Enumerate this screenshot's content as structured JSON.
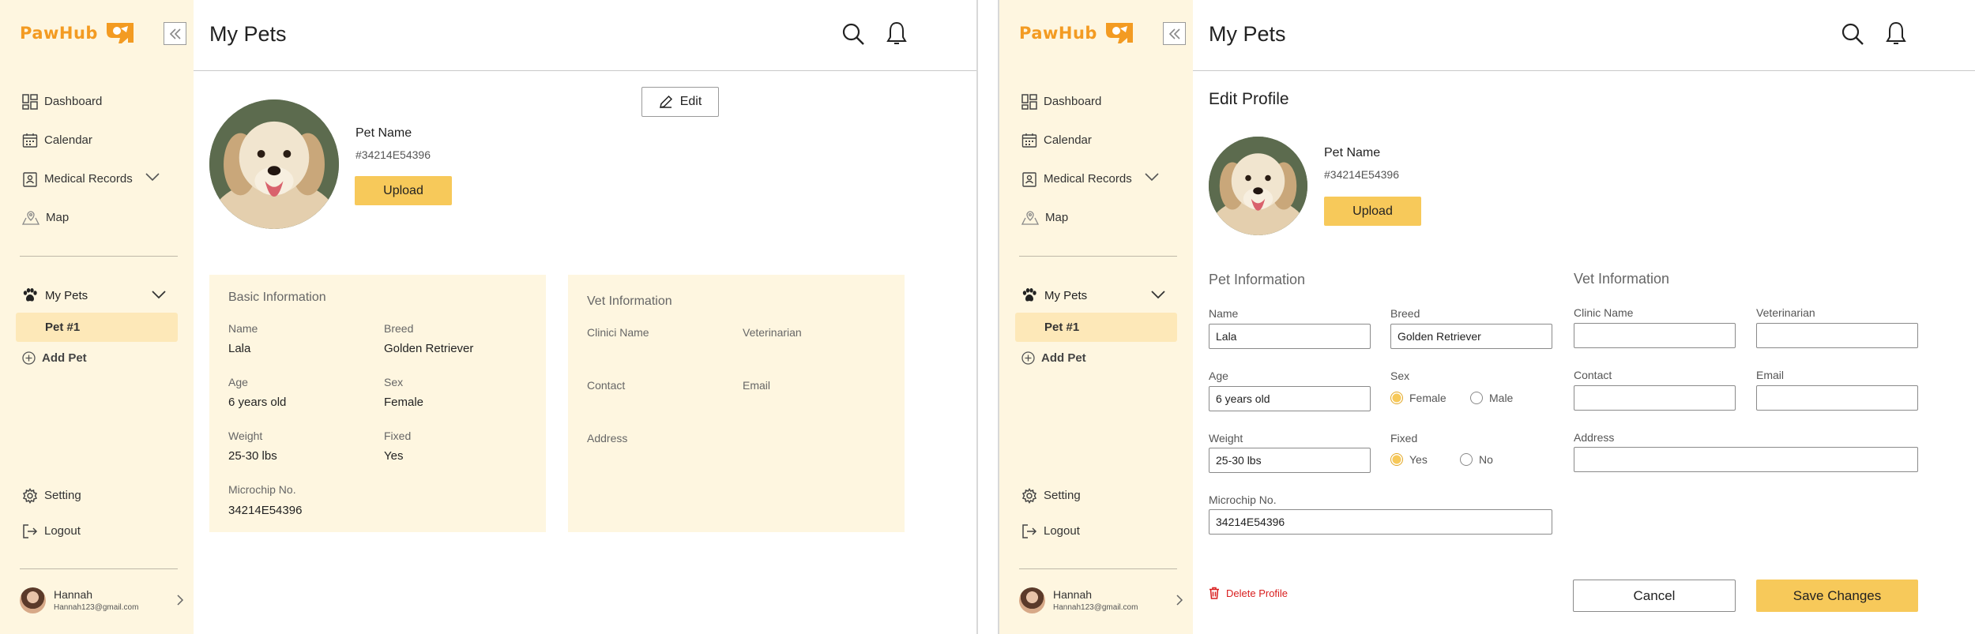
{
  "app": {
    "logo_text": "PawHub"
  },
  "sidebar": {
    "nav": [
      {
        "label": "Dashboard"
      },
      {
        "label": "Calendar"
      },
      {
        "label": "Medical Records"
      },
      {
        "label": "Map"
      }
    ],
    "my_pets_label": "My Pets",
    "pets": [
      {
        "label": "Pet #1"
      }
    ],
    "add_pet_label": "Add Pet",
    "bottom": [
      {
        "label": "Setting"
      },
      {
        "label": "Logout"
      }
    ],
    "user": {
      "name": "Hannah",
      "email": "Hannah123@gmail.com"
    }
  },
  "header": {
    "title": "My Pets"
  },
  "profile": {
    "pet_name": "Pet Name",
    "pet_id": "#34214E54396",
    "upload_label": "Upload",
    "edit_label": "Edit"
  },
  "basic_info": {
    "title": "Basic Information",
    "fields": [
      {
        "label": "Name",
        "value": "Lala"
      },
      {
        "label": "Breed",
        "value": "Golden Retriever"
      },
      {
        "label": "Age",
        "value": "6 years old"
      },
      {
        "label": "Sex",
        "value": "Female"
      },
      {
        "label": "Weight",
        "value": "25-30 lbs"
      },
      {
        "label": "Fixed",
        "value": "Yes"
      },
      {
        "label": "Microchip No.",
        "value": "34214E54396"
      }
    ]
  },
  "vet_info": {
    "title": "Vet Information",
    "labels": {
      "clinic": "Clinici Name",
      "vet": "Veterinarian",
      "contact": "Contact",
      "email": "Email",
      "address": "Address"
    }
  },
  "edit_form": {
    "title": "Edit Profile",
    "pet_section_title": "Pet Information",
    "vet_section_title": "Vet Information",
    "name": {
      "label": "Name",
      "value": "Lala"
    },
    "breed": {
      "label": "Breed",
      "value": "Golden Retriever"
    },
    "age": {
      "label": "Age",
      "value": "6 years old"
    },
    "sex": {
      "label": "Sex",
      "options": [
        "Female",
        "Male"
      ],
      "selected": "Female"
    },
    "weight": {
      "label": "Weight",
      "value": "25-30 lbs"
    },
    "fixed": {
      "label": "Fixed",
      "options": [
        "Yes",
        "No"
      ],
      "selected": "Yes"
    },
    "microchip": {
      "label": "Microchip No.",
      "value": "34214E54396"
    },
    "clinic": {
      "label": "Clinic Name",
      "value": ""
    },
    "veterinarian": {
      "label": "Veterinarian",
      "value": ""
    },
    "contact": {
      "label": "Contact",
      "value": ""
    },
    "email": {
      "label": "Email",
      "value": ""
    },
    "address": {
      "label": "Address",
      "value": ""
    },
    "delete_label": "Delete Profile",
    "cancel_label": "Cancel",
    "save_label": "Save Changes"
  },
  "colors": {
    "accent": "#f7c95a",
    "brand": "#f39b22",
    "sidebar_bg": "#fef6e0",
    "active_item_bg": "#fde8b8",
    "danger": "#d91e1e"
  },
  "icons": [
    "double-chevron-left-icon",
    "dashboard-icon",
    "calendar-icon",
    "medical-records-icon",
    "map-icon",
    "paw-icon",
    "plus-circle-icon",
    "gear-icon",
    "logout-icon",
    "chevron-right-icon",
    "search-icon",
    "bell-icon",
    "pencil-icon",
    "trash-icon"
  ]
}
